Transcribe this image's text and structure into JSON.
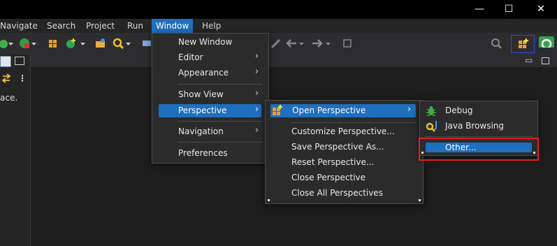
{
  "window_controls": {
    "minimize": "—",
    "maximize": "☐",
    "close": "✕"
  },
  "menubar": {
    "items": [
      "Navigate",
      "Search",
      "Project",
      "Run",
      "Window",
      "Help"
    ]
  },
  "left_pane": {
    "snippet": "ace."
  },
  "window_menu": {
    "items": [
      "New Window",
      "Editor",
      "Appearance",
      "Show View",
      "Perspective",
      "Navigation",
      "Preferences"
    ]
  },
  "perspective_menu": {
    "items": [
      "Open Perspective",
      "Customize Perspective...",
      "Save Perspective As...",
      "Reset Perspective...",
      "Close Perspective",
      "Close All Perspectives"
    ]
  },
  "open_perspective_menu": {
    "items": [
      "Debug",
      "Java Browsing",
      "Other..."
    ]
  },
  "colors": {
    "accent": "#1f6fbf",
    "highlight_box": "#e02020",
    "toolbar_focus_box": "#4040e0"
  }
}
